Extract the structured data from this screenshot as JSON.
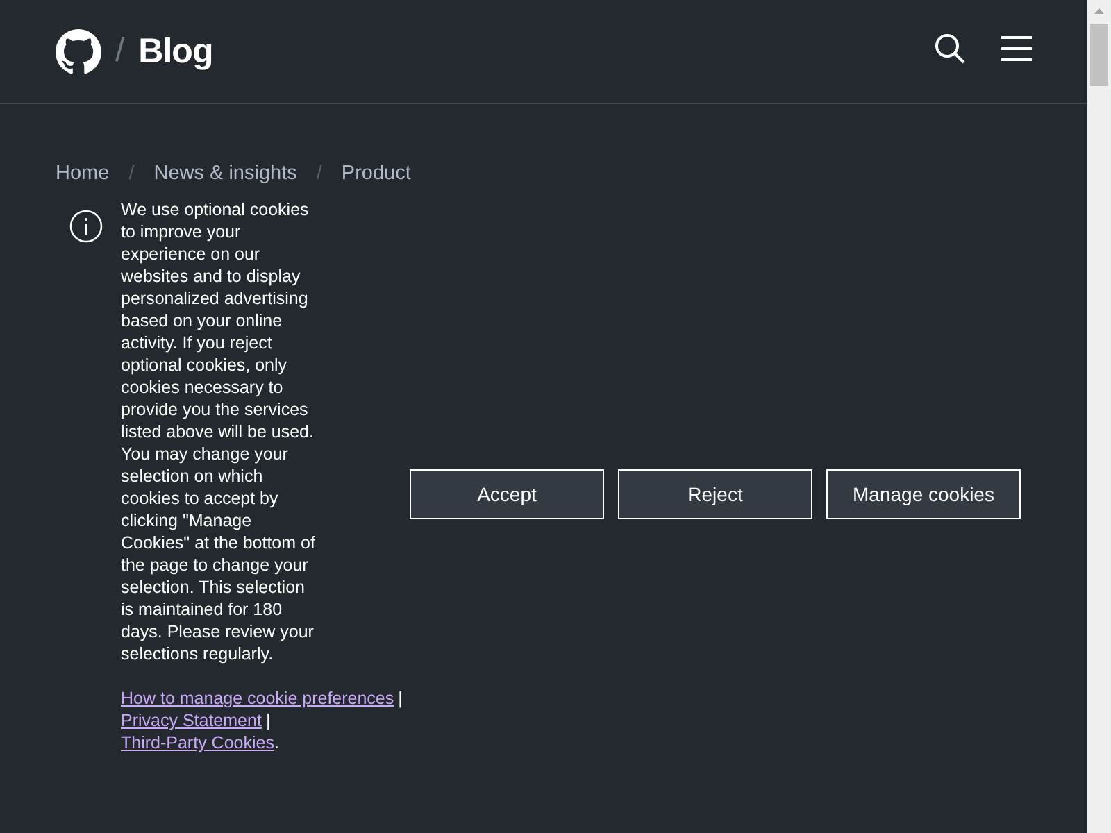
{
  "header": {
    "separator": "/",
    "title": "Blog"
  },
  "breadcrumb": {
    "separator": "/",
    "items": [
      "Home",
      "News & insights",
      "Product"
    ]
  },
  "cookie_banner": {
    "message": "We use optional cookies to improve your experience on our websites and to display personalized advertising based on your online activity. If you reject optional cookies, only cookies necessary to provide you the services listed above will be used. You may change your selection on which cookies to accept by clicking \"Manage Cookies\" at the bottom of the page to change your selection. This selection is maintained for 180 days. Please review your selections regularly.",
    "links": [
      "How to manage cookie preferences",
      "Privacy Statement",
      "Third-Party Cookies"
    ],
    "link_separator": "|",
    "links_end": ".",
    "buttons": [
      "Accept",
      "Reject",
      "Manage cookies"
    ]
  }
}
